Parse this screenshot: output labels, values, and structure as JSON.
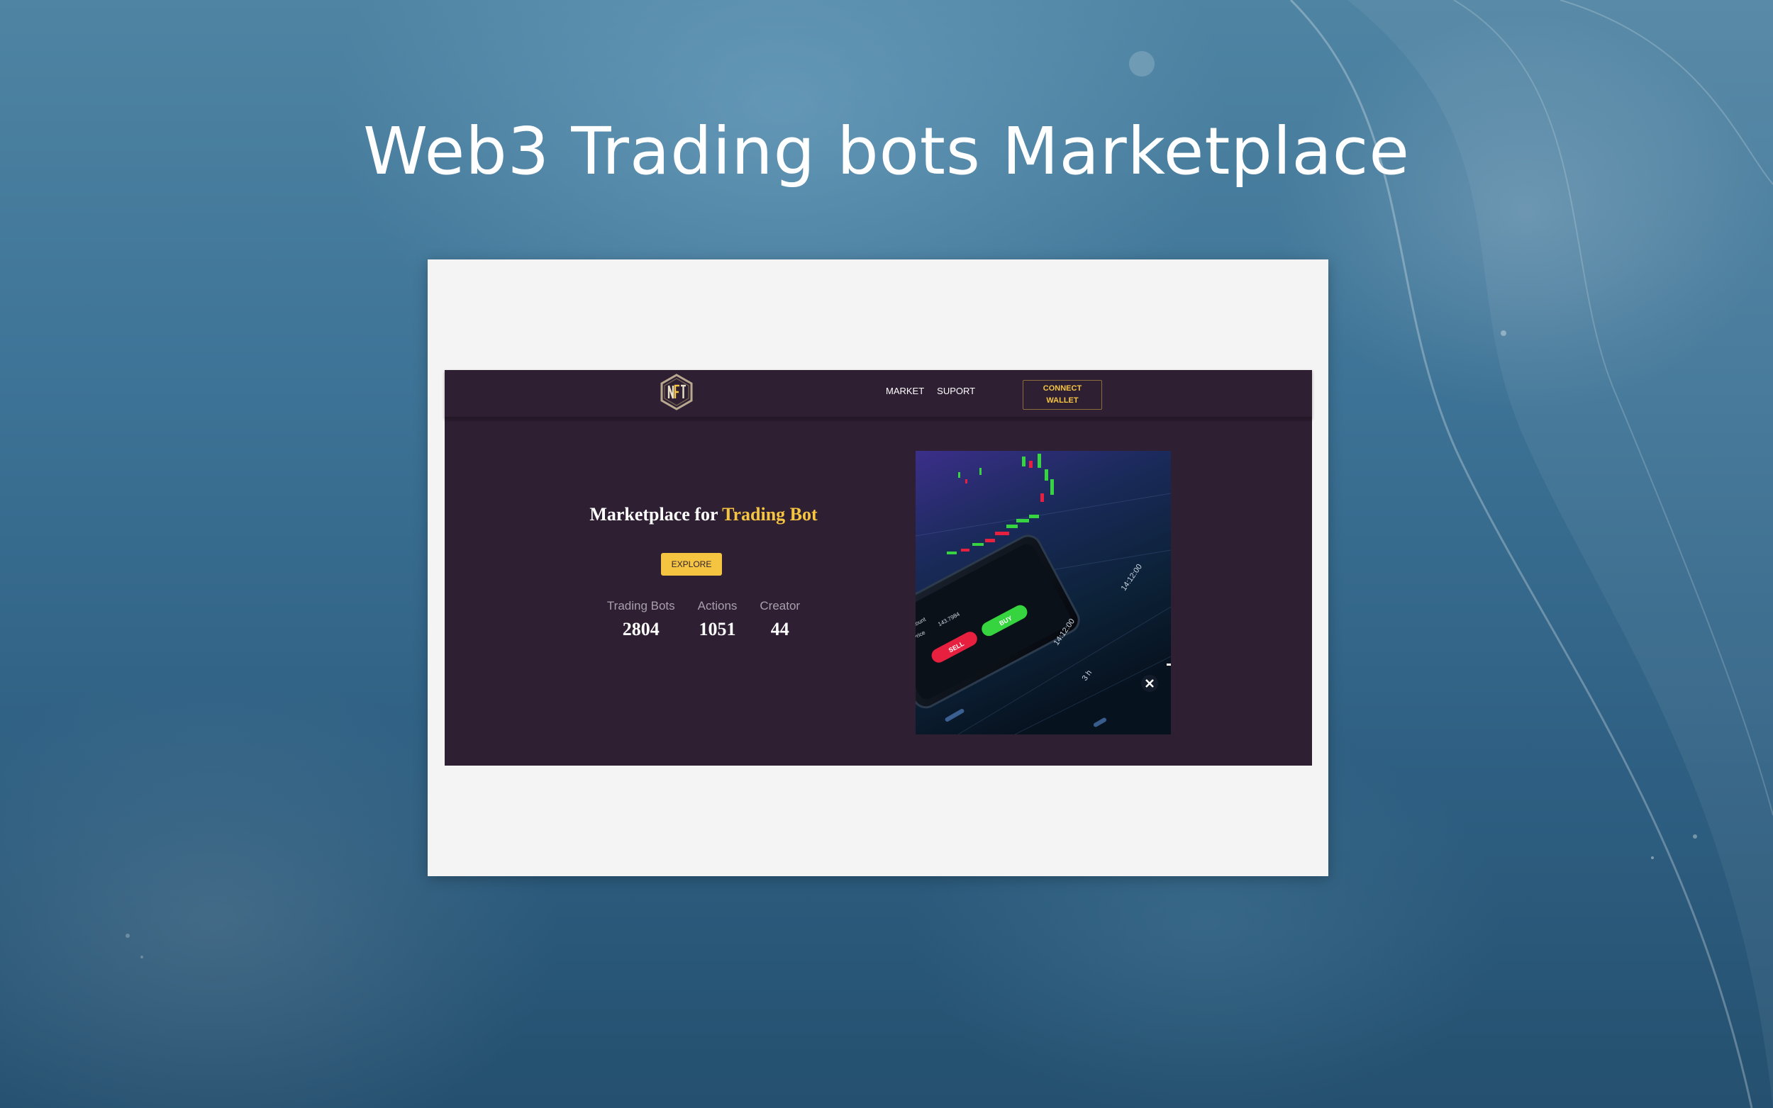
{
  "slide": {
    "title": "Web3 Trading bots Marketplace"
  },
  "site": {
    "logo_icon": "nft-hexagon-logo",
    "nav": {
      "items": [
        {
          "label": "MARKET"
        },
        {
          "label": "SUPORT"
        }
      ],
      "connect_wallet_label": "CONNECT WALLET"
    },
    "hero": {
      "title_prefix": "Marketplace for ",
      "title_accent": "Trading Bot",
      "explore_label": "EXPLORE",
      "stats": [
        {
          "label": "Trading Bots",
          "value": "2804"
        },
        {
          "label": "Actions",
          "value": "1051"
        },
        {
          "label": "Creator",
          "value": "44"
        }
      ],
      "image": {
        "buy_label": "BUY",
        "sell_label": "SELL",
        "time_label": "14:12:00",
        "interval_label": "3 h",
        "amount_label": "Amount",
        "price_label": "Price",
        "price_value": "143.7984"
      }
    }
  },
  "colors": {
    "site_background": "#2e1f33",
    "accent": "#f5c542",
    "buy_green": "#36d43f",
    "sell_red": "#e8203f"
  }
}
